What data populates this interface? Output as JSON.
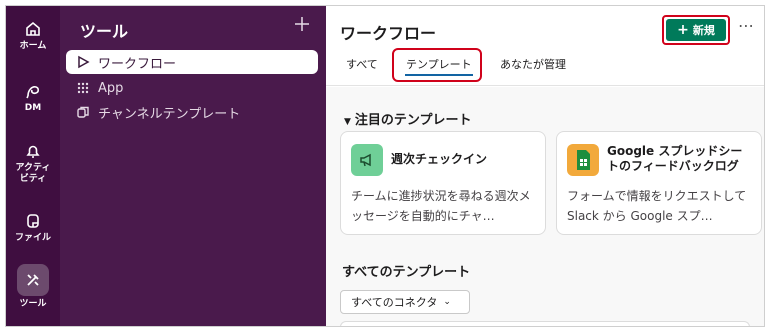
{
  "rail": {
    "items": [
      {
        "label": "ホーム",
        "icon": "home-icon"
      },
      {
        "label": "DM",
        "icon": "dm-icon"
      },
      {
        "label": "アクティビティ",
        "icon": "bell-icon"
      },
      {
        "label": "ファイル",
        "icon": "files-icon"
      },
      {
        "label": "ツール",
        "icon": "tools-icon"
      }
    ]
  },
  "sidebar": {
    "title": "ツール",
    "items": [
      {
        "label": "ワークフロー",
        "icon": "workflow-icon"
      },
      {
        "label": "App",
        "icon": "app-grid-icon"
      },
      {
        "label": "チャンネルテンプレート",
        "icon": "channel-template-icon"
      }
    ]
  },
  "main": {
    "title": "ワークフロー",
    "new_button": "新規",
    "tabs": [
      {
        "label": "すべて"
      },
      {
        "label": "テンプレート"
      },
      {
        "label": "あなたが管理"
      }
    ],
    "featured_heading": "注目のテンプレート",
    "cards": [
      {
        "title": "週次チェックイン",
        "description": "チームに進捗状況を尋ねる週次メッセージを自動的にチャ…",
        "icon": "megaphone-icon"
      },
      {
        "title": "Google スプレッドシートのフィードバックログ",
        "description": "フォームで情報をリクエストして Slack から Google スプ…",
        "icon": "spreadsheet-icon"
      }
    ],
    "all_heading": "すべてのテンプレート",
    "filter_label": "すべてのコネクタ"
  },
  "colors": {
    "rail_bg": "#3f0e40",
    "sidebar_bg": "#4a1a4c",
    "accent_green": "#007a5a",
    "highlight_red": "#d0021b"
  }
}
